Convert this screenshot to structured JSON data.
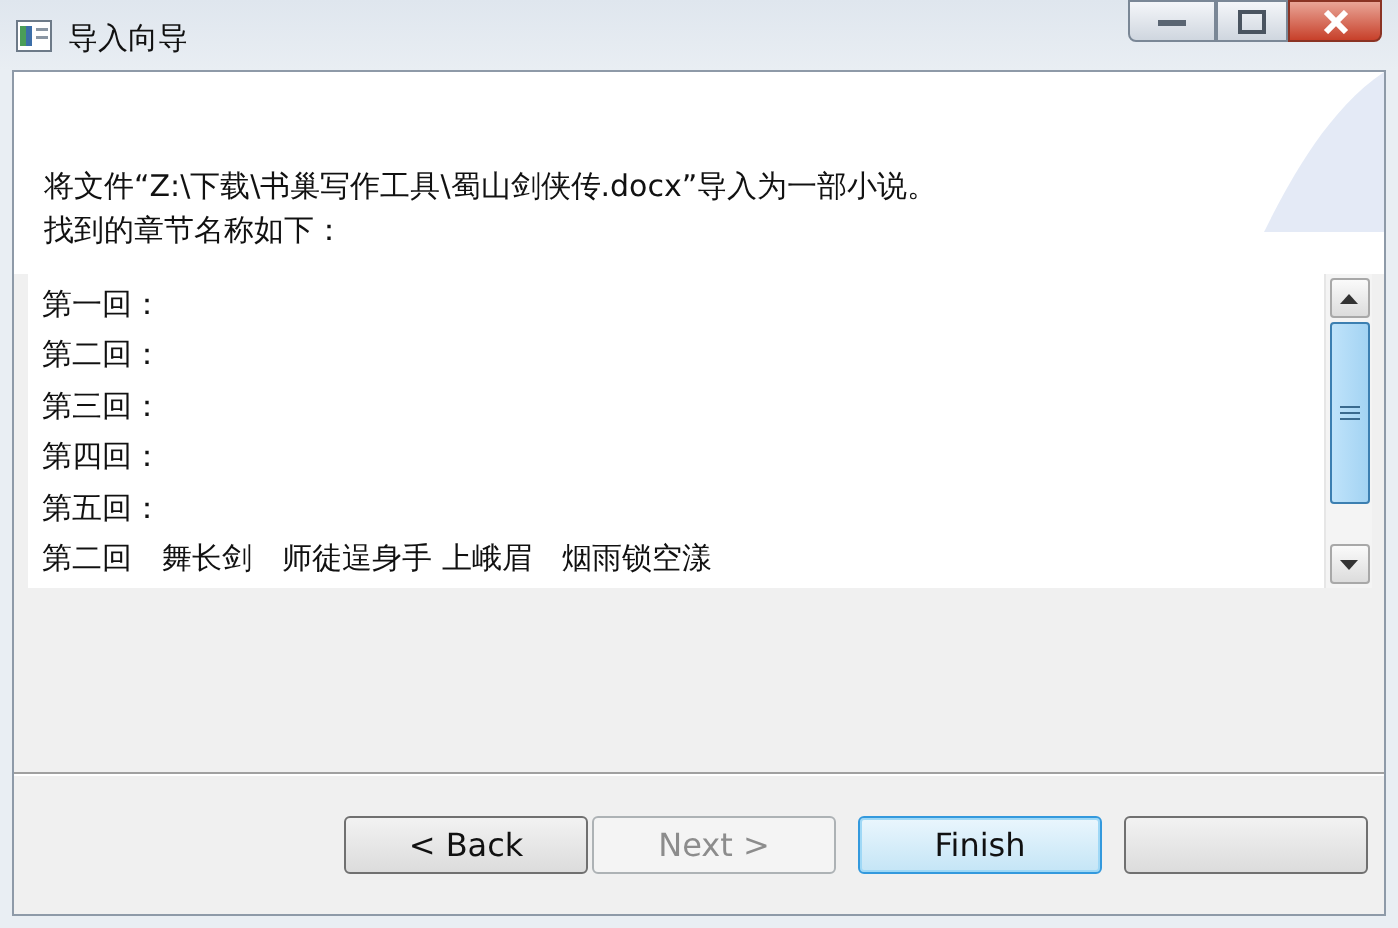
{
  "window": {
    "title": "导入向导"
  },
  "header": {
    "lines": [
      "将文件“Z:\\下载\\书巢写作工具\\蜀山剑侠传.docx”导入为一部小说。",
      "找到的章节名称如下："
    ]
  },
  "chapter_list": {
    "items": [
      "第一回：",
      "第二回：",
      "第三回：",
      "第四回：",
      "第五回：",
      "第二回　舞长剑　师徒逞身手 上峨眉　烟雨锁空漾"
    ]
  },
  "buttons": [
    {
      "label": "< Back",
      "disabled": false,
      "default": false
    },
    {
      "label": "Next >",
      "disabled": true,
      "default": false
    },
    {
      "label": "Finish",
      "disabled": false,
      "default": true
    },
    {
      "disabled": false,
      "default": false
    }
  ]
}
